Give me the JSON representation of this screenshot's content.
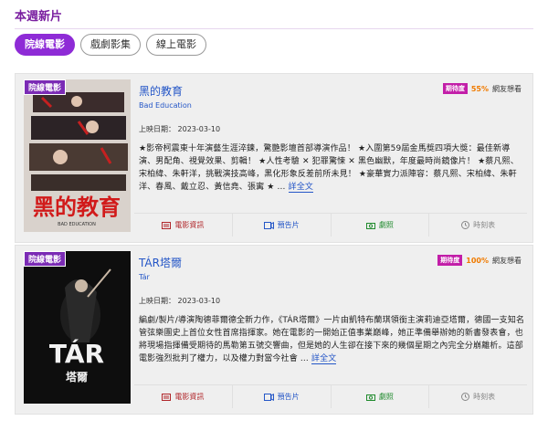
{
  "page": {
    "title": "本週新片"
  },
  "tabs": [
    {
      "label": "院線電影",
      "active": true
    },
    {
      "label": "戲劇影集",
      "active": false
    },
    {
      "label": "線上電影",
      "active": false
    }
  ],
  "movies": [
    {
      "badge": "院線電影",
      "title": "黑的教育",
      "title_en": "Bad Education",
      "rating_label": "期待度",
      "rating_value": "55%",
      "rating_suffix": "網友想看",
      "release": "上映日期： 2023-03-10",
      "description": "★影帝柯震東十年演藝生涯淬鍊，驚艷影壇首部導演作品！ ★入圍第59屆金馬獎四項大獎：最佳新導演、男配角、視覺效果、剪輯！ ★人性考驗 ✕ 犯罪驚悚 ✕ 黑色幽默，年度最時尚鏡像片！ ★蔡凡熙、宋柏緯、朱軒洋，挑戰演技高峰，黑化形象反差前所未見！ ★豪華實力派陣容：蔡凡熙、宋柏緯、朱軒洋、春風、戴立忍、黃信堯、張寗 ★ ...",
      "more": "詳全文",
      "poster_text": "黑的教育",
      "poster_sub": "BAD EDUCATION"
    },
    {
      "badge": "院線電影",
      "title": "TÁR塔爾",
      "title_en": "Tár",
      "rating_label": "期待度",
      "rating_value": "100%",
      "rating_suffix": "網友想看",
      "release": "上映日期： 2023-03-10",
      "description": "編劇/製片/導演陶德菲爾德全新力作，《TÁR塔爾》一片由凱特布蘭琪領銜主演莉迪亞塔爾，德國一支知名管弦樂團史上首位女性首席指揮家。她在電影的一開始正值事業巔峰，她正準備舉辦她的新書發表會，也將現場指揮備受期待的馬勒第五號交響曲，但是她的人生卻在接下來的幾個星期之內完全分崩離析。這部電影強烈批判了權力，以及權力對當今社會 ...",
      "more": "詳全文",
      "poster_text": "TÁR",
      "poster_sub": "塔爾"
    }
  ],
  "actions": {
    "info": "電影資訊",
    "trailer": "預告片",
    "stills": "劇照",
    "showtimes": "時刻表"
  },
  "colors": {
    "accent": "#8e2bd6",
    "link": "#2456c7",
    "rating_badge": "#c21ea8",
    "rating_value": "#f07b00"
  }
}
